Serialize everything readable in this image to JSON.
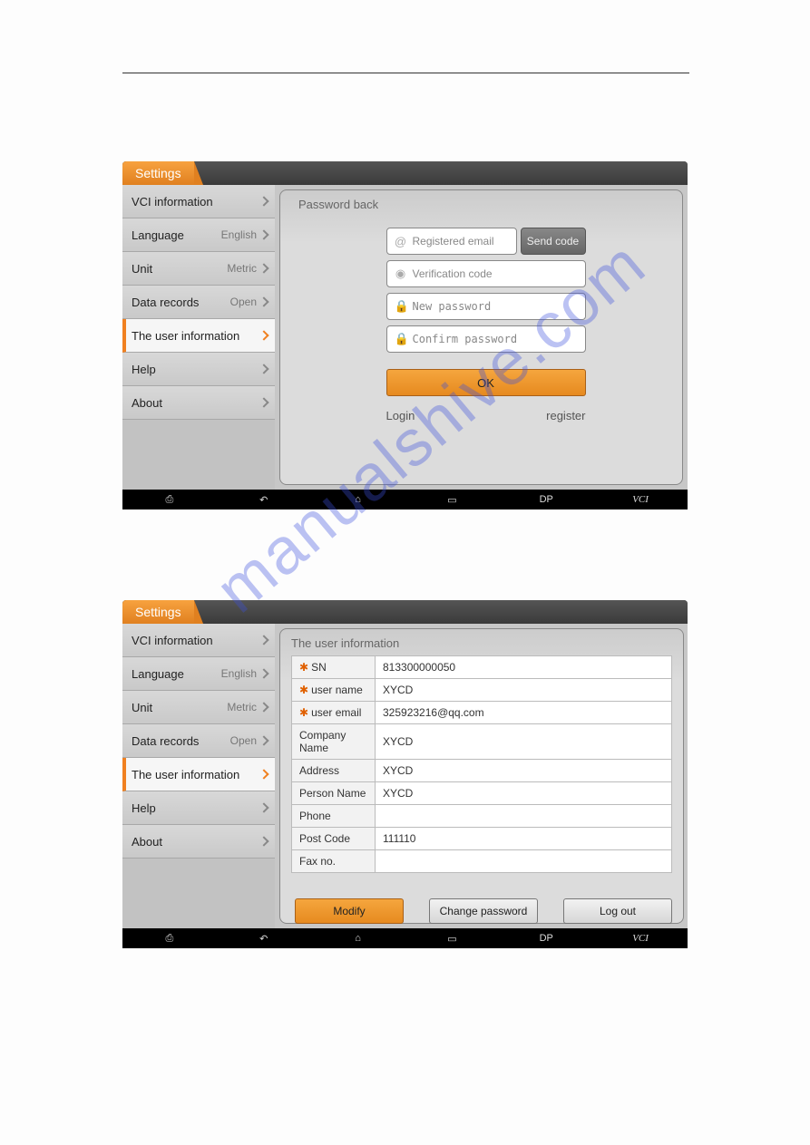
{
  "watermark": "manualshive.com",
  "screen1": {
    "title": "Settings",
    "sidebar": [
      {
        "label": "VCI information",
        "value": ""
      },
      {
        "label": "Language",
        "value": "English"
      },
      {
        "label": "Unit",
        "value": "Metric"
      },
      {
        "label": "Data records",
        "value": "Open"
      },
      {
        "label": "The user information",
        "value": "",
        "active": true
      },
      {
        "label": "Help",
        "value": ""
      },
      {
        "label": "About",
        "value": ""
      }
    ],
    "panel_title": "Password back",
    "fields": {
      "email_ph": "Registered email",
      "sendcode": "Send code",
      "verify_ph": "Verification code",
      "newpw_ph": "New password",
      "confirm_ph": "Confirm password"
    },
    "ok": "OK",
    "login": "Login",
    "register": "register",
    "nav": {
      "dp": "DP",
      "vci": "VCI"
    }
  },
  "screen2": {
    "title": "Settings",
    "sidebar": [
      {
        "label": "VCI information",
        "value": ""
      },
      {
        "label": "Language",
        "value": "English"
      },
      {
        "label": "Unit",
        "value": "Metric"
      },
      {
        "label": "Data records",
        "value": "Open"
      },
      {
        "label": "The user information",
        "value": "",
        "active": true
      },
      {
        "label": "Help",
        "value": ""
      },
      {
        "label": "About",
        "value": ""
      }
    ],
    "panel_title": "The user information",
    "rows": [
      {
        "req": true,
        "k": "SN",
        "v": "813300000050"
      },
      {
        "req": true,
        "k": "user name",
        "v": "XYCD"
      },
      {
        "req": true,
        "k": "user email",
        "v": "325923216@qq.com"
      },
      {
        "req": false,
        "k": "Company Name",
        "v": "XYCD"
      },
      {
        "req": false,
        "k": "Address",
        "v": "XYCD"
      },
      {
        "req": false,
        "k": "Person Name",
        "v": "XYCD"
      },
      {
        "req": false,
        "k": "Phone",
        "v": ""
      },
      {
        "req": false,
        "k": "Post Code",
        "v": "111110"
      },
      {
        "req": false,
        "k": "Fax no.",
        "v": ""
      }
    ],
    "buttons": {
      "modify": "Modify",
      "changepw": "Change password",
      "logout": "Log out"
    },
    "nav": {
      "dp": "DP",
      "vci": "VCI"
    }
  }
}
